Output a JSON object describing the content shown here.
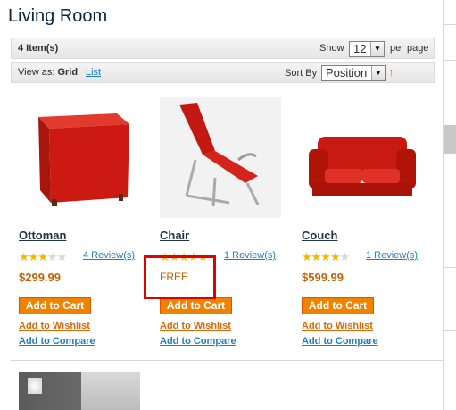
{
  "page": {
    "title": "Living Room"
  },
  "toolbar": {
    "items_count": "4 Item(s)",
    "show_label": "Show",
    "limit_value": "12",
    "per_page_label": "per page",
    "view_as_label": "View as:",
    "view_grid": "Grid",
    "view_list": "List",
    "sort_by_label": "Sort By",
    "sort_value": "Position",
    "sort_direction_icon": "arrow-up-icon"
  },
  "products": [
    {
      "name": "Ottoman",
      "rating": 3,
      "reviews": "4 Review(s)",
      "price": "$299.99",
      "add_to_cart": "Add to Cart",
      "wishlist": "Add to Wishlist",
      "compare": "Add to Compare"
    },
    {
      "name": "Chair",
      "rating": 5,
      "reviews": "1 Review(s)",
      "price": "FREE",
      "add_to_cart": "Add to Cart",
      "wishlist": "Add to Wishlist",
      "compare": "Add to Compare"
    },
    {
      "name": "Couch",
      "rating": 4,
      "reviews": "1 Review(s)",
      "price": "$599.99",
      "add_to_cart": "Add to Cart",
      "wishlist": "Add to Wishlist",
      "compare": "Add to Compare"
    }
  ],
  "colors": {
    "accent": "#f18200",
    "link": "#1e7ec8",
    "price": "#c76200",
    "highlight": "#e00000"
  }
}
